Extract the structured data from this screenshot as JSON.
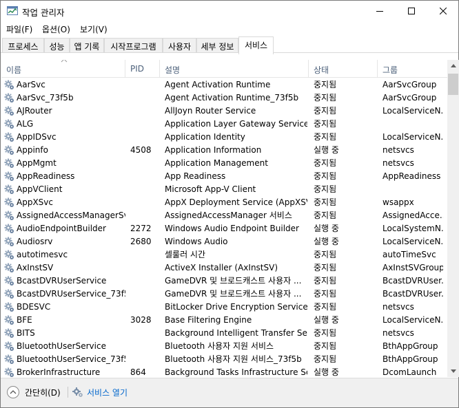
{
  "window": {
    "title": "작업 관리자",
    "controls": {
      "minimize": "minimize-icon",
      "maximize": "maximize-icon",
      "close": "close-icon"
    }
  },
  "menu": [
    "파일(F)",
    "옵션(O)",
    "보기(V)"
  ],
  "tabs": [
    "프로세스",
    "성능",
    "앱 기록",
    "시작프로그램",
    "사용자",
    "세부 정보",
    "서비스"
  ],
  "active_tab": "서비스",
  "columns": {
    "name": "이름",
    "pid": "PID",
    "description": "설명",
    "status": "상태",
    "group": "그룹"
  },
  "services": [
    {
      "name": "AarSvc",
      "pid": "",
      "description": "Agent Activation Runtime",
      "status": "중지됨",
      "group": "AarSvcGroup"
    },
    {
      "name": "AarSvc_73f5b",
      "pid": "",
      "description": "Agent Activation Runtime_73f5b",
      "status": "중지됨",
      "group": "AarSvcGroup"
    },
    {
      "name": "AJRouter",
      "pid": "",
      "description": "AllJoyn Router Service",
      "status": "중지됨",
      "group": "LocalServiceN..."
    },
    {
      "name": "ALG",
      "pid": "",
      "description": "Application Layer Gateway Service",
      "status": "중지됨",
      "group": ""
    },
    {
      "name": "AppIDSvc",
      "pid": "",
      "description": "Application Identity",
      "status": "중지됨",
      "group": "LocalServiceN..."
    },
    {
      "name": "Appinfo",
      "pid": "4508",
      "description": "Application Information",
      "status": "실행 중",
      "group": "netsvcs"
    },
    {
      "name": "AppMgmt",
      "pid": "",
      "description": "Application Management",
      "status": "중지됨",
      "group": "netsvcs"
    },
    {
      "name": "AppReadiness",
      "pid": "",
      "description": "App Readiness",
      "status": "중지됨",
      "group": "AppReadiness"
    },
    {
      "name": "AppVClient",
      "pid": "",
      "description": "Microsoft App-V Client",
      "status": "중지됨",
      "group": ""
    },
    {
      "name": "AppXSvc",
      "pid": "",
      "description": "AppX Deployment Service (AppXSV...",
      "status": "중지됨",
      "group": "wsappx"
    },
    {
      "name": "AssignedAccessManagerSvc",
      "pid": "",
      "description": "AssignedAccessManager 서비스",
      "status": "중지됨",
      "group": "AssignedAcce..."
    },
    {
      "name": "AudioEndpointBuilder",
      "pid": "2272",
      "description": "Windows Audio Endpoint Builder",
      "status": "실행 중",
      "group": "LocalSystemN..."
    },
    {
      "name": "Audiosrv",
      "pid": "2680",
      "description": "Windows Audio",
      "status": "실행 중",
      "group": "LocalServiceN..."
    },
    {
      "name": "autotimesvc",
      "pid": "",
      "description": "셀룰러 시간",
      "status": "중지됨",
      "group": "autoTimeSvc"
    },
    {
      "name": "AxInstSV",
      "pid": "",
      "description": "ActiveX Installer (AxInstSV)",
      "status": "중지됨",
      "group": "AxInstSVGroup"
    },
    {
      "name": "BcastDVRUserService",
      "pid": "",
      "description": "GameDVR 및 브로드캐스트 사용자 ...",
      "status": "중지됨",
      "group": "BcastDVRUser..."
    },
    {
      "name": "BcastDVRUserService_73f5b",
      "pid": "",
      "description": "GameDVR 및 브로드캐스트 사용자 ...",
      "status": "중지됨",
      "group": "BcastDVRUser..."
    },
    {
      "name": "BDESVC",
      "pid": "",
      "description": "BitLocker Drive Encryption Service",
      "status": "중지됨",
      "group": "netsvcs"
    },
    {
      "name": "BFE",
      "pid": "3028",
      "description": "Base Filtering Engine",
      "status": "실행 중",
      "group": "LocalServiceN..."
    },
    {
      "name": "BITS",
      "pid": "",
      "description": "Background Intelligent Transfer Ser...",
      "status": "중지됨",
      "group": "netsvcs"
    },
    {
      "name": "BluetoothUserService",
      "pid": "",
      "description": "Bluetooth 사용자 지원 서비스",
      "status": "중지됨",
      "group": "BthAppGroup"
    },
    {
      "name": "BluetoothUserService_73f5b",
      "pid": "",
      "description": "Bluetooth 사용자 지원 서비스_73f5b",
      "status": "중지됨",
      "group": "BthAppGroup"
    },
    {
      "name": "BrokerInfrastructure",
      "pid": "864",
      "description": "Background Tasks Infrastructure Ser...",
      "status": "실행 중",
      "group": "DcomLaunch"
    }
  ],
  "footer": {
    "fewer_details": "간단히(D)",
    "open_services": "서비스 열기"
  }
}
